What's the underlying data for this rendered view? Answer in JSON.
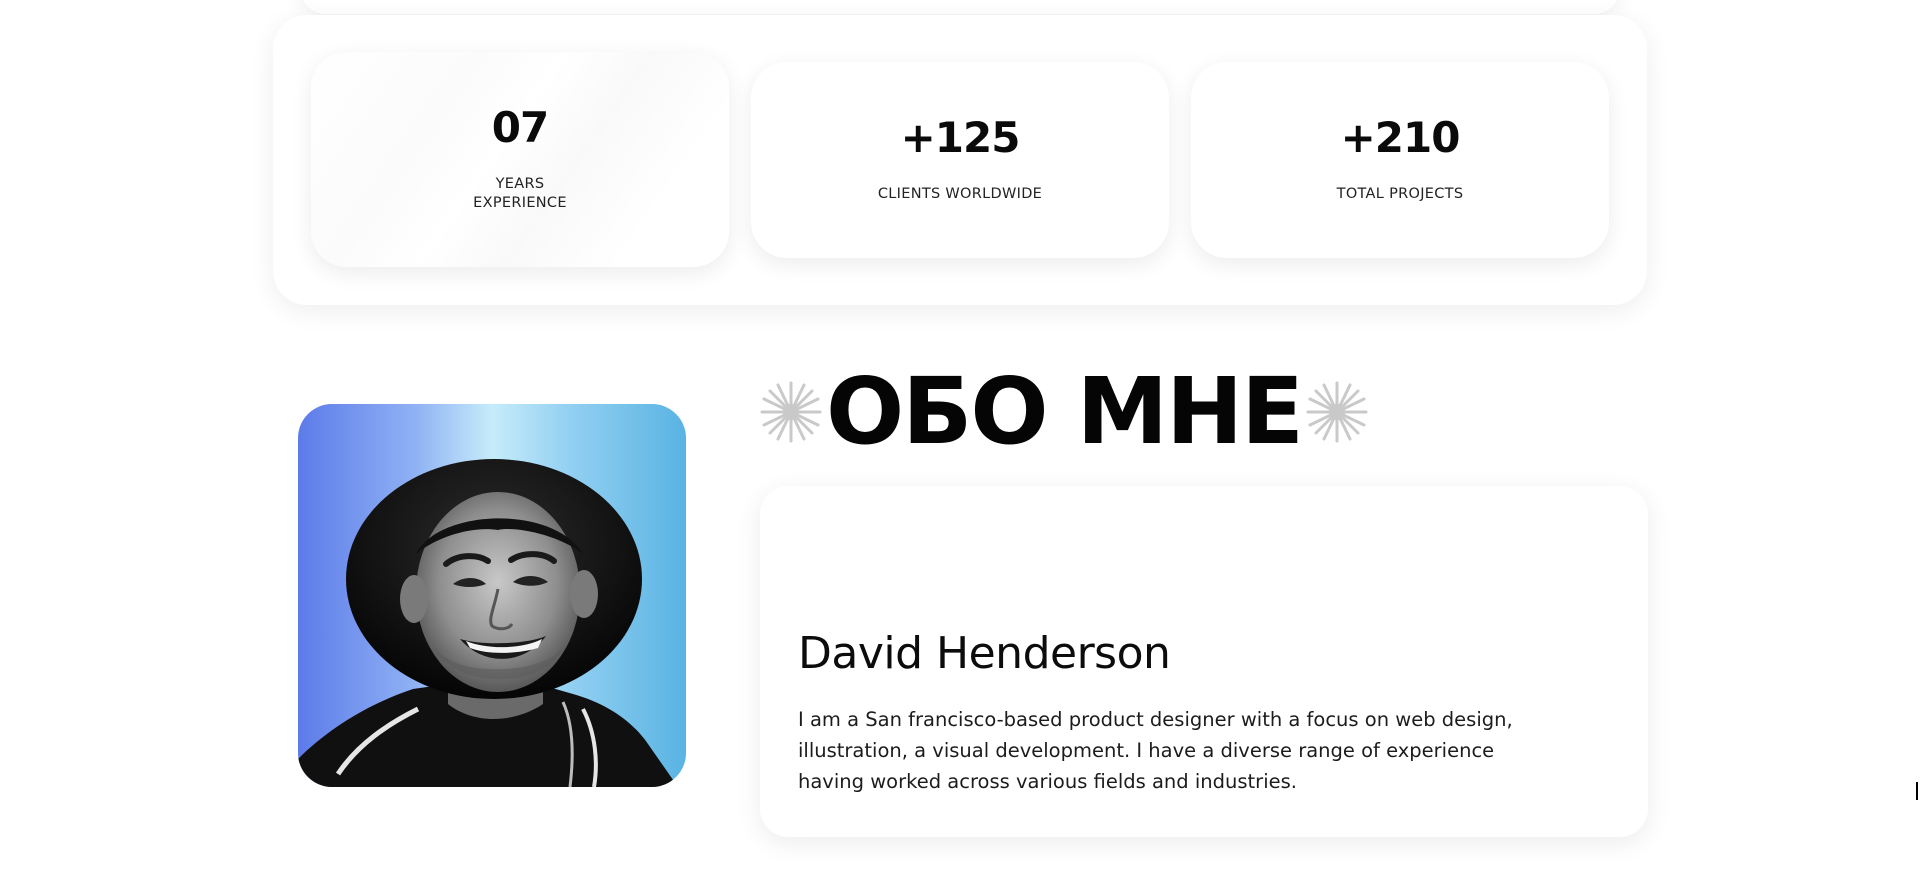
{
  "stats": [
    {
      "value": "07",
      "label": "YEARS\nEXPERIENCE"
    },
    {
      "value": "+125",
      "label": "CLIENTS WORLDWIDE"
    },
    {
      "value": "+210",
      "label": "TOTAL PROJECTS"
    }
  ],
  "about": {
    "heading": "ОБО МНЕ",
    "name": "David Henderson",
    "bio": "I am a San francisco-based product designer with a focus on web design, illustration, a visual development. I have a diverse range of experience having worked across various fields and industries."
  },
  "colors": {
    "photo_gradient_left": "#5d7be9",
    "photo_gradient_right": "#59b3e3",
    "sparkle": "#c9c9c9"
  },
  "icons": {
    "heading_decoration": "sparkle-icon",
    "profile": "avatar"
  }
}
